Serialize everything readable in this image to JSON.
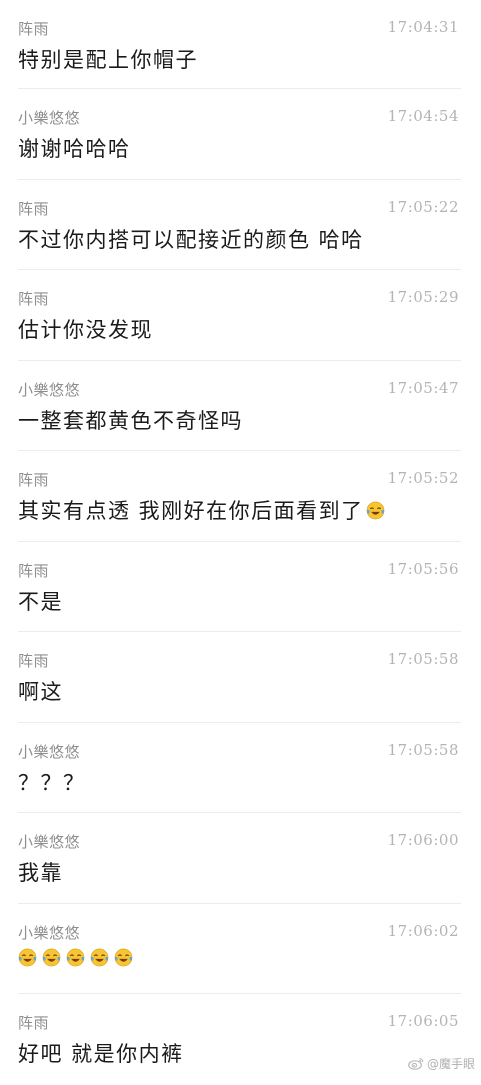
{
  "messages": [
    {
      "sender": "阵雨",
      "time": "17:04:31",
      "text": "特别是配上你帽子"
    },
    {
      "sender": "小樂悠悠",
      "time": "17:04:54",
      "text": "谢谢哈哈哈"
    },
    {
      "sender": "阵雨",
      "time": "17:05:22",
      "text": "不过你内搭可以配接近的颜色  哈哈"
    },
    {
      "sender": "阵雨",
      "time": "17:05:29",
      "text": "估计你没发现"
    },
    {
      "sender": "小樂悠悠",
      "time": "17:05:47",
      "text": "一整套都黄色不奇怪吗"
    },
    {
      "sender": "阵雨",
      "time": "17:05:52",
      "text": "其实有点透  我刚好在你后面看到了",
      "emojis": [
        "laugh-cry-emoji"
      ]
    },
    {
      "sender": "阵雨",
      "time": "17:05:56",
      "text": "不是"
    },
    {
      "sender": "阵雨",
      "time": "17:05:58",
      "text": "啊这"
    },
    {
      "sender": "小樂悠悠",
      "time": "17:05:58",
      "text": "？？？"
    },
    {
      "sender": "小樂悠悠",
      "time": "17:06:00",
      "text": "我靠"
    },
    {
      "sender": "小樂悠悠",
      "time": "17:06:02",
      "text": "",
      "emojis": [
        "laugh-cry-emoji",
        "laugh-cry-emoji",
        "laugh-cry-emoji",
        "laugh-cry-emoji",
        "laugh-cry-emoji"
      ]
    },
    {
      "sender": "阵雨",
      "time": "17:06:05",
      "text": "好吧  就是你内裤"
    }
  ],
  "watermark": {
    "icon": "weibo-icon",
    "text": "@魔手眼"
  },
  "colors": {
    "background": "#ffffff",
    "sender": "#8e8e8e",
    "time": "#b4b4b4",
    "text": "#1b1b1b",
    "divider": "#ececec",
    "emoji_face": "#f7c531",
    "emoji_tear": "#5aa6e6"
  }
}
